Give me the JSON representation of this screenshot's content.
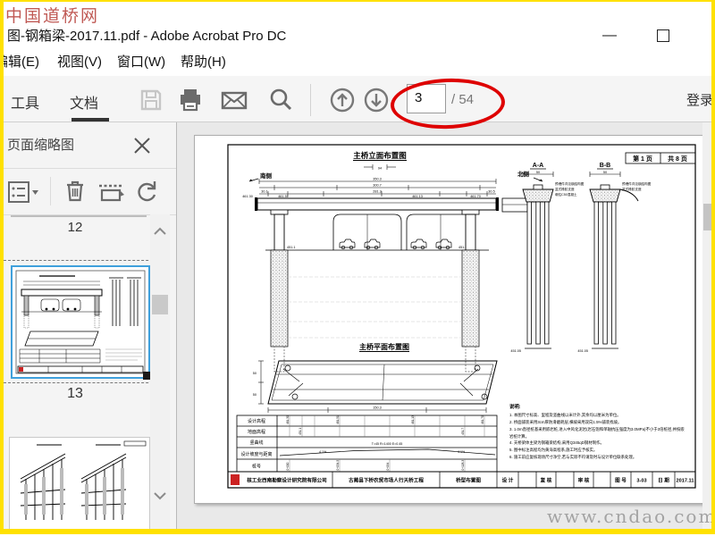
{
  "watermarks": {
    "top": "中国道桥网",
    "bottom": "www.cndao.com"
  },
  "window": {
    "title": "图-钢箱梁-2017.11.pdf - Adobe Acrobat Pro DC",
    "controls": {
      "minimize": "—",
      "maximize": "□",
      "close": "✕"
    },
    "menus": [
      "编辑(E)",
      "视图(V)",
      "窗口(W)",
      "帮助(H)"
    ]
  },
  "toolbar": {
    "tools_tab": "工具",
    "document_tab": "文档",
    "page_current": "3",
    "page_total": "/ 54",
    "login_label": "登录"
  },
  "sidebar": {
    "title": "页面缩略图",
    "thumb_prev_number": "12",
    "thumb_selected_number": "13"
  },
  "drawing": {
    "page_header": {
      "left": "第 1 页",
      "right": "共 8 页"
    },
    "elevation_title": "主桥立面布置图",
    "plan_title": "主桥平面布置图",
    "south_label": "南侧",
    "north_label": "北侧",
    "section_labels": [
      "A-A",
      "B-B"
    ],
    "section_callouts": [
      "预埋件详见钢结构图",
      "盆式橡胶支座",
      "墩柱C50混凝土"
    ],
    "section_base_elev": "451.05",
    "dims": [
      "350.3",
      "300.7",
      "281.3",
      "94",
      "48.78",
      "30.1",
      "30.5",
      "50",
      "50",
      "150.3"
    ],
    "elevations": [
      "461.30",
      "461.51",
      "461.13",
      "461.70"
    ],
    "ground_elevs": [
      "451.1",
      "451.7"
    ],
    "stations": [
      "0+000",
      "0+034.5",
      "0+094",
      "0+128.3"
    ],
    "profile_rows": [
      "设计高程",
      "地面高程",
      "竖曲线",
      "设计坡度与距离",
      "桩号"
    ],
    "slope_values": [
      "4.1%",
      "4.1%"
    ],
    "curve_value": "T=45  R=1400  E=0.45",
    "notes_title": "说明:",
    "notes": [
      "1. 本图尺寸标高、里程及竖曲线以米计外,其余均以厘米为单位。",
      "2. 桥面铺装采用3cm厚防滑磨耗层,横坡采用双向1.5%铺装找坡。",
      "3. 1.0m直径桩基采用嵌岩桩,进入中风化泥岩(岩石饱和单轴抗压强度为3.0MPa)不小于3倍桩径,并按嵌岩桩计算。",
      "4. 天桥梁体主梁为钢箱梁结构,采用Q345qD钢材制作。",
      "5. 图中标注高程均为黄海高程系,施工时应予核实。",
      "6. 施工前应复核现场尺寸净空,若与实际不符请及时与设计单位联系处理。"
    ],
    "titleblock": {
      "company": "核工业西南勘察设计研究院有限公司",
      "project": "古蔺县下桥农贸市场人行天桥工程",
      "drawing_title": "桥型布置图",
      "design_label": "设 计",
      "check_label": "复 核",
      "review_label": "审 核",
      "number_label": "图 号",
      "number_value": "3-03",
      "date_label": "日 期",
      "date_value": "2017.11"
    }
  },
  "colors": {
    "accent_yellow": "#ffe100",
    "annotation_red": "#de0000",
    "selection_blue": "#3fa0dc",
    "watermark_red": "#c05a55"
  }
}
